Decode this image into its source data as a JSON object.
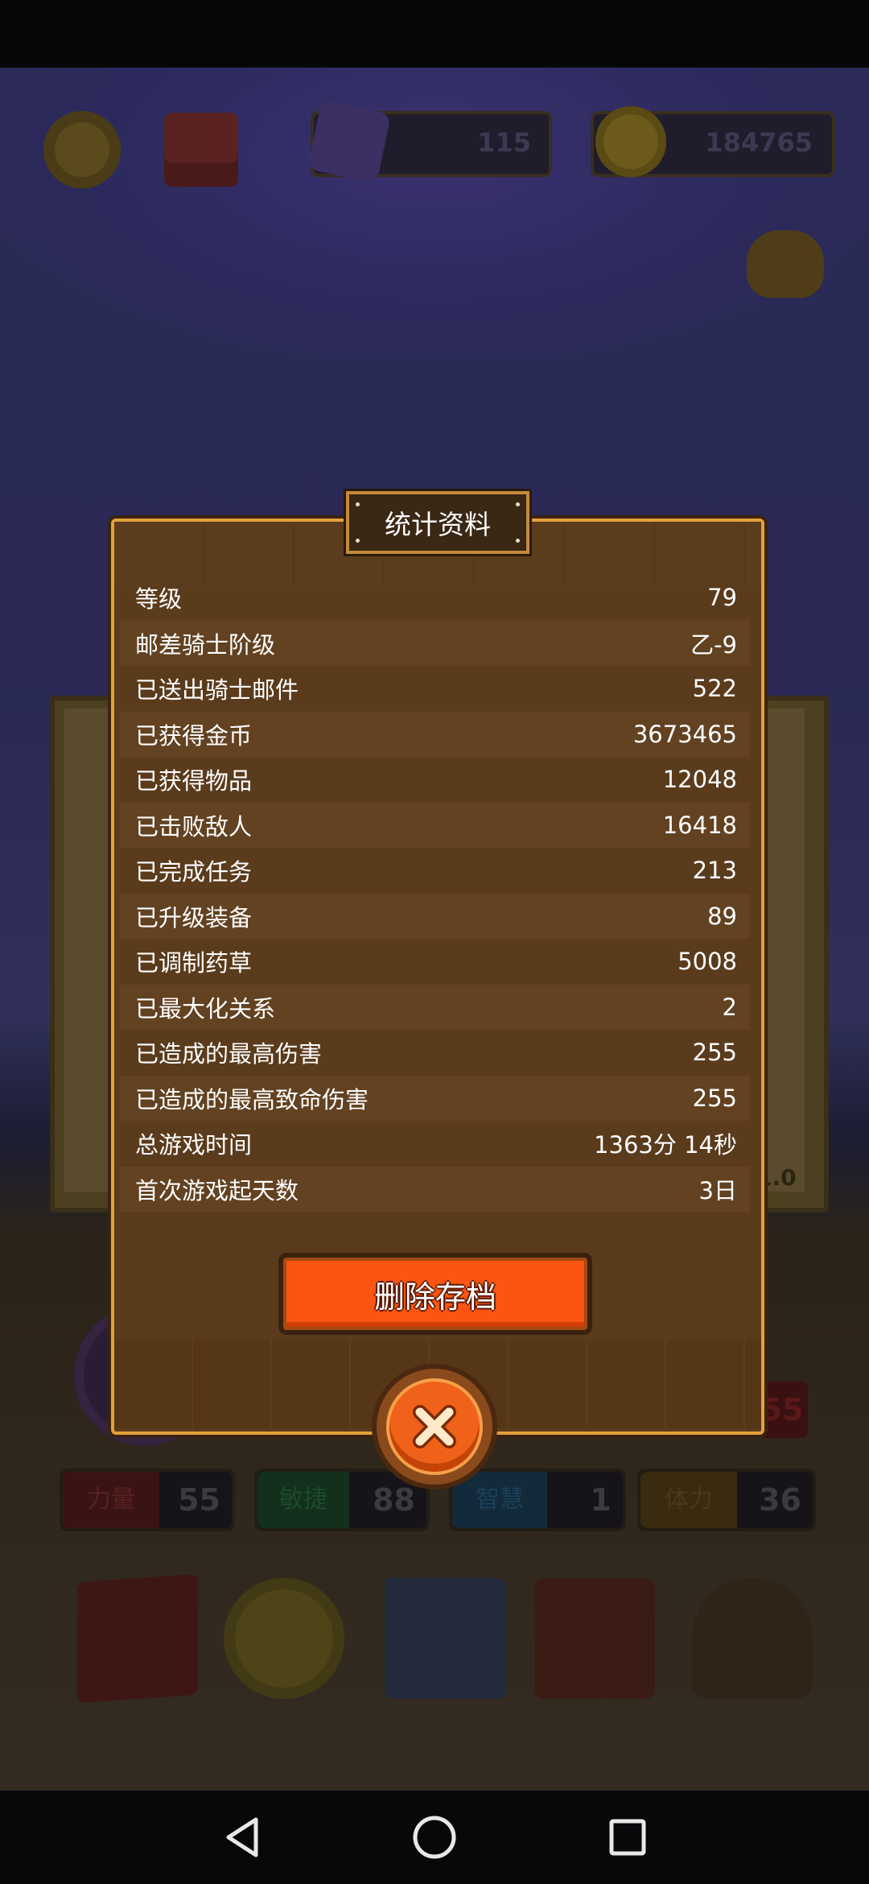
{
  "header": {
    "gems": "115",
    "coins": "184765"
  },
  "background": {
    "version_text": "1.0",
    "right_value": "55",
    "stats": [
      {
        "label": "力量",
        "value": "55"
      },
      {
        "label": "敏捷",
        "value": "88"
      },
      {
        "label": "智慧",
        "value": "1"
      },
      {
        "label": "体力",
        "value": "36"
      }
    ]
  },
  "dialog": {
    "title": "统计资料",
    "rows": [
      {
        "label": "等级",
        "value": "79"
      },
      {
        "label": "邮差骑士阶级",
        "value": "乙-9"
      },
      {
        "label": "已送出骑士邮件",
        "value": "522"
      },
      {
        "label": "已获得金币",
        "value": "3673465"
      },
      {
        "label": "已获得物品",
        "value": "12048"
      },
      {
        "label": "已击败敌人",
        "value": "16418"
      },
      {
        "label": "已完成任务",
        "value": "213"
      },
      {
        "label": "已升级装备",
        "value": "89"
      },
      {
        "label": "已调制药草",
        "value": "5008"
      },
      {
        "label": "已最大化关系",
        "value": "2"
      },
      {
        "label": "已造成的最高伤害",
        "value": "255"
      },
      {
        "label": "已造成的最高致命伤害",
        "value": "255"
      },
      {
        "label": "总游戏时间",
        "value": "1363分 14秒"
      },
      {
        "label": "首次游戏起天数",
        "value": "3日"
      }
    ],
    "delete_label": "删除存档"
  },
  "colors": {
    "panel": "#5a3b1c",
    "panel_border": "#e3a13a",
    "delete_button": "#fb5413",
    "close_button": "#f0621a"
  }
}
